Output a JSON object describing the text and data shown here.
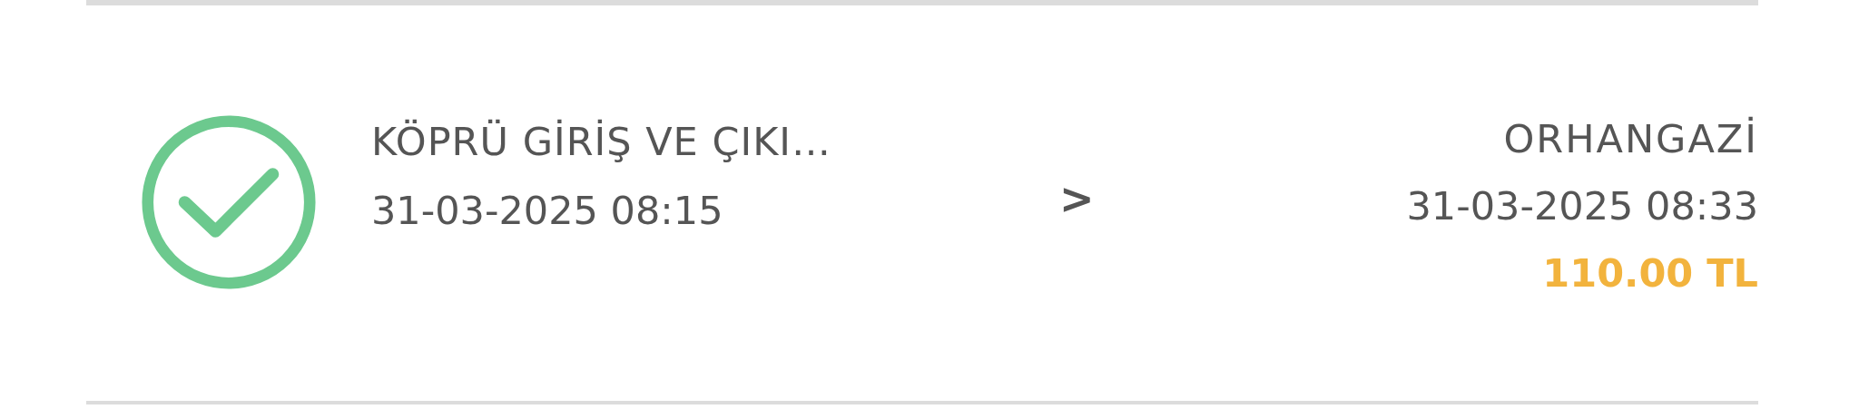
{
  "trip": {
    "completed": true,
    "entry_name": "KÖPRÜ GİRİŞ VE ÇIKI…",
    "entry_time": "31-03-2025 08:15",
    "separator": ">",
    "exit_name": "ORHANGAZİ",
    "exit_time": "31-03-2025 08:33",
    "amount": "110.00 TL"
  }
}
